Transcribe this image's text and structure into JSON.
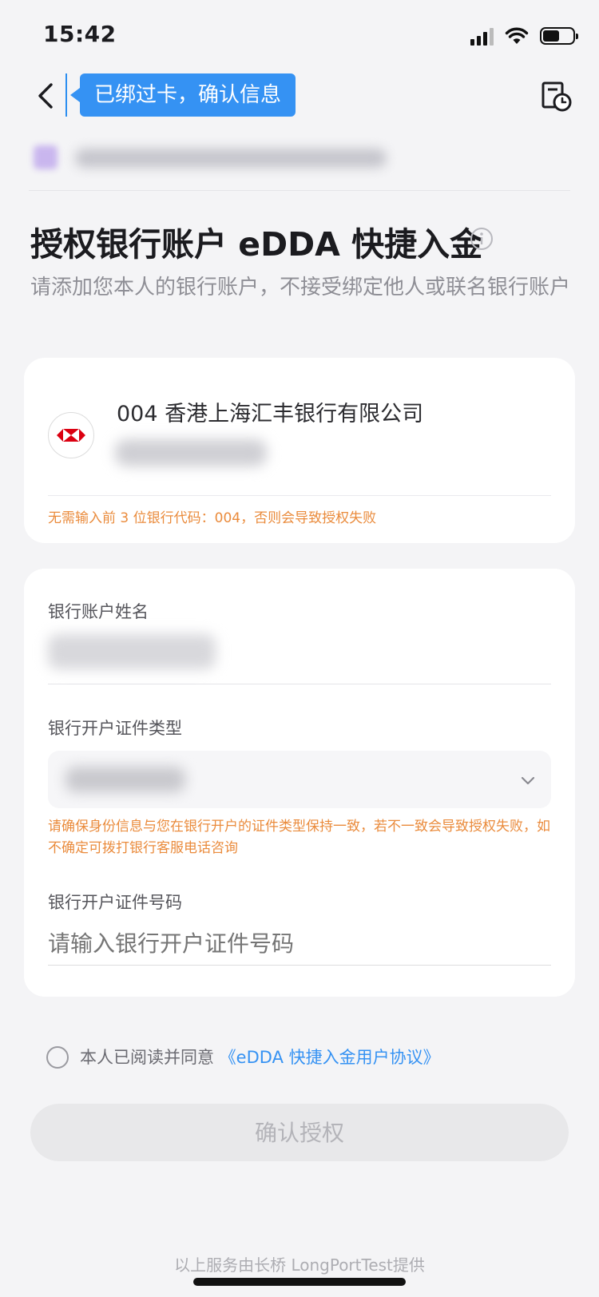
{
  "status_bar": {
    "time": "15:42",
    "battery_level": 0.55,
    "icons": [
      "signal-icon",
      "wifi-icon",
      "battery-icon"
    ]
  },
  "nav": {
    "back_icon": "chevron-left-icon",
    "tooltip": "已绑过卡，确认信息",
    "history_icon": "history-icon"
  },
  "page": {
    "title": "授权银行账户 eDDA 快捷入金",
    "subtitle": "请添加您本人的银行账户，不接受绑定他人或联名银行账户"
  },
  "bank_card": {
    "bank_name": "004 香港上海汇丰银行有限公司",
    "warning": "无需输入前 3 位银行代码：004，否则会导致授权失败"
  },
  "form": {
    "account_name_label": "银行账户姓名",
    "id_type_label": "银行开户证件类型",
    "id_type_warning": "请确保身份信息与您在银行开户的证件类型保持一致，若不一致会导致授权失败，如不确定可拨打银行客服电话咨询",
    "id_number_label": "银行开户证件号码",
    "id_number_placeholder": "请输入银行开户证件号码"
  },
  "agreement": {
    "text": "本人已阅读并同意",
    "link": "《eDDA 快捷入金用户协议》",
    "checked": false
  },
  "confirm_button": "确认授权",
  "footer": "以上服务由长桥 LongPortTest提供",
  "colors": {
    "accent": "#3592f3",
    "warning": "#ea8b3c",
    "hsbc_red": "#db0011"
  }
}
